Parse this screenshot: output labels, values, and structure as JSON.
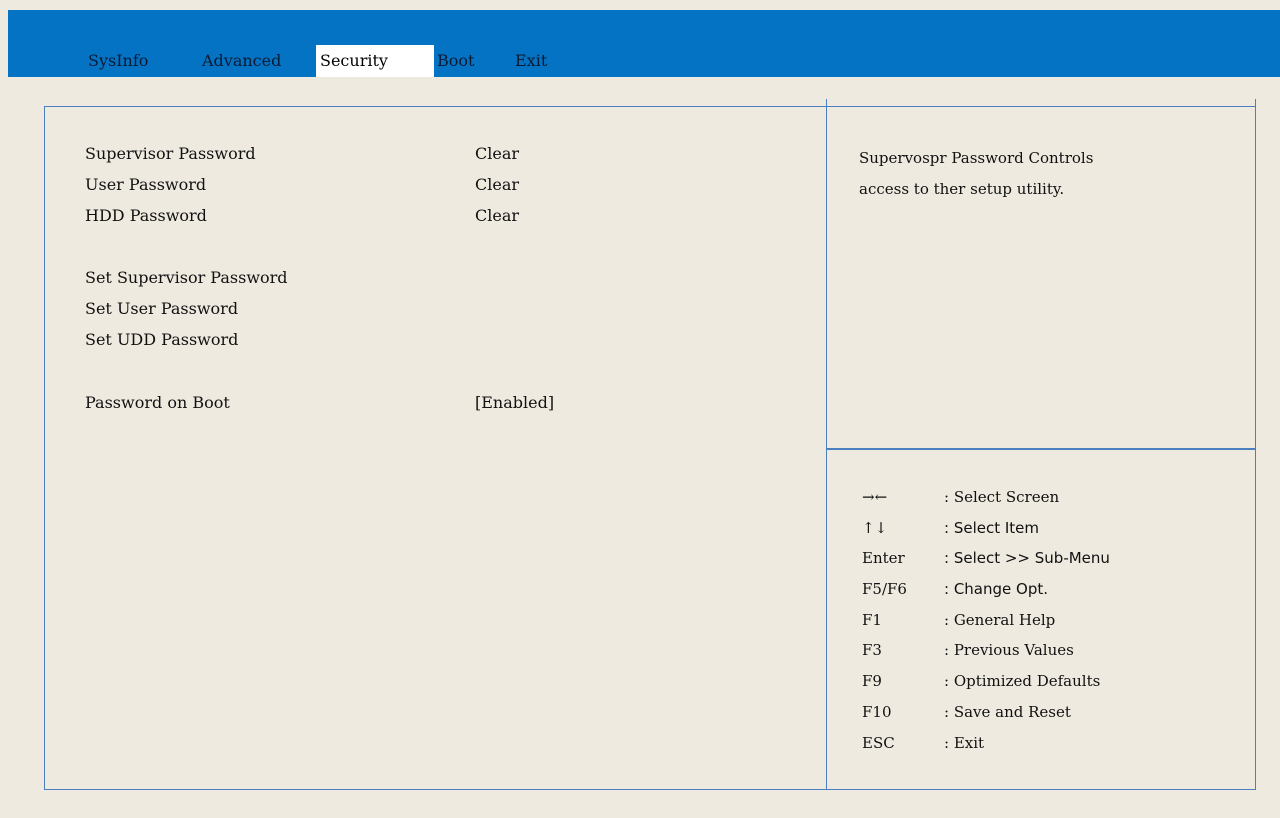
{
  "tabs": [
    {
      "label": "SysInfo",
      "active": false
    },
    {
      "label": "Advanced",
      "active": false
    },
    {
      "label": "Security",
      "active": true
    },
    {
      "label": "Boot",
      "active": false
    },
    {
      "label": "Exit",
      "active": false
    }
  ],
  "settings": {
    "supervisor_password": {
      "label": "Supervisor Password",
      "value": "Clear"
    },
    "user_password": {
      "label": "User Password",
      "value": "Clear"
    },
    "hdd_password": {
      "label": "HDD Password",
      "value": "Clear"
    },
    "set_supervisor_password": {
      "label": "Set Supervisor Password"
    },
    "set_user_password": {
      "label": "Set User Password"
    },
    "set_udd_password": {
      "label": "Set UDD Password"
    },
    "password_on_boot": {
      "label": "Password on Boot",
      "value": "[Enabled]"
    }
  },
  "help": {
    "line1": "Supervospr Password Controls",
    "line2": "access to ther setup utility."
  },
  "keys": [
    {
      "key": "→←",
      "desc": ": Select Screen"
    },
    {
      "key": "↑↓",
      "desc": ":  Select Item"
    },
    {
      "key": "Enter",
      "desc": ":  Select >> Sub-Menu"
    },
    {
      "key": "F5/F6",
      "desc": ":  Change Opt."
    },
    {
      "key": "F1",
      "desc": ": General Help"
    },
    {
      "key": "F3",
      "desc": ": Previous Values"
    },
    {
      "key": "F9",
      "desc": ": Optimized Defaults"
    },
    {
      "key": "F10",
      "desc": ": Save and Reset"
    },
    {
      "key": "ESC",
      "desc": ": Exit"
    }
  ]
}
